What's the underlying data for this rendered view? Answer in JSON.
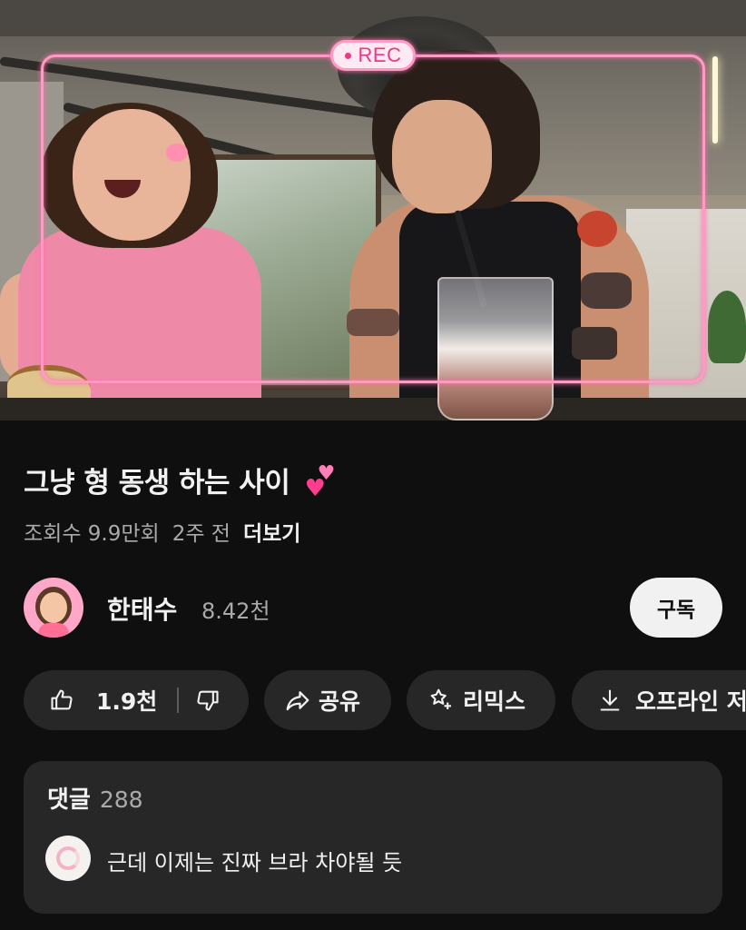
{
  "video": {
    "overlay_badge": "REC",
    "colors": {
      "frame": "#ff9ac4",
      "badge_text": "#e83b85"
    }
  },
  "info": {
    "title": "그냥 형 동생 하는 사이",
    "title_emoji": "two-hearts",
    "views": "조회수 9.9만회",
    "age": "2주 전",
    "more": "더보기"
  },
  "channel": {
    "name": "한태수",
    "subscribers": "8.42천",
    "subscribe_label": "구독"
  },
  "actions": {
    "like_count": "1.9천",
    "share_label": "공유",
    "remix_label": "리믹스",
    "offline_label": "오프라인 저"
  },
  "comments": {
    "label": "댓글",
    "count": "288",
    "top_comment": "근데 이제는 진짜 브라 차야될 듯"
  },
  "colors": {
    "background": "#0f0f0f",
    "pill": "#272727",
    "text": "#f1f1f1",
    "secondary": "#aaaaaa"
  }
}
